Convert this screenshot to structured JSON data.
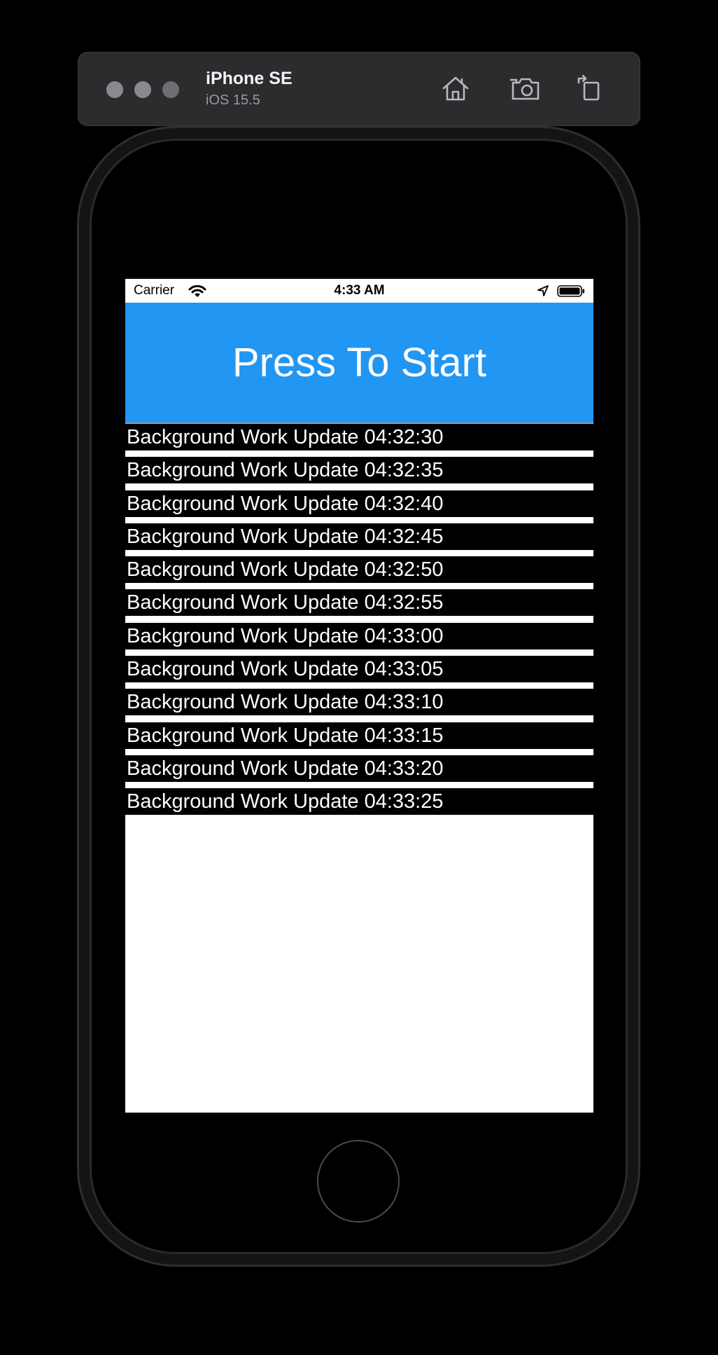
{
  "simulator": {
    "device_name": "iPhone SE",
    "os_version": "iOS 15.5",
    "toolbar_icons": [
      "home-icon",
      "screenshot-icon",
      "rotate-icon"
    ]
  },
  "status_bar": {
    "carrier": "Carrier",
    "time": "4:33 AM",
    "icons": [
      "wifi-icon",
      "location-arrow-icon",
      "battery-icon"
    ]
  },
  "main": {
    "start_button_label": "Press To Start",
    "start_button_color": "#2196f3",
    "updates": [
      "Background Work Update 04:32:30",
      "Background Work Update 04:32:35",
      "Background Work Update 04:32:40",
      "Background Work Update 04:32:45",
      "Background Work Update 04:32:50",
      "Background Work Update 04:32:55",
      "Background Work Update 04:33:00",
      "Background Work Update 04:33:05",
      "Background Work Update 04:33:10",
      "Background Work Update 04:33:15",
      "Background Work Update 04:33:20",
      "Background Work Update 04:33:25"
    ]
  }
}
